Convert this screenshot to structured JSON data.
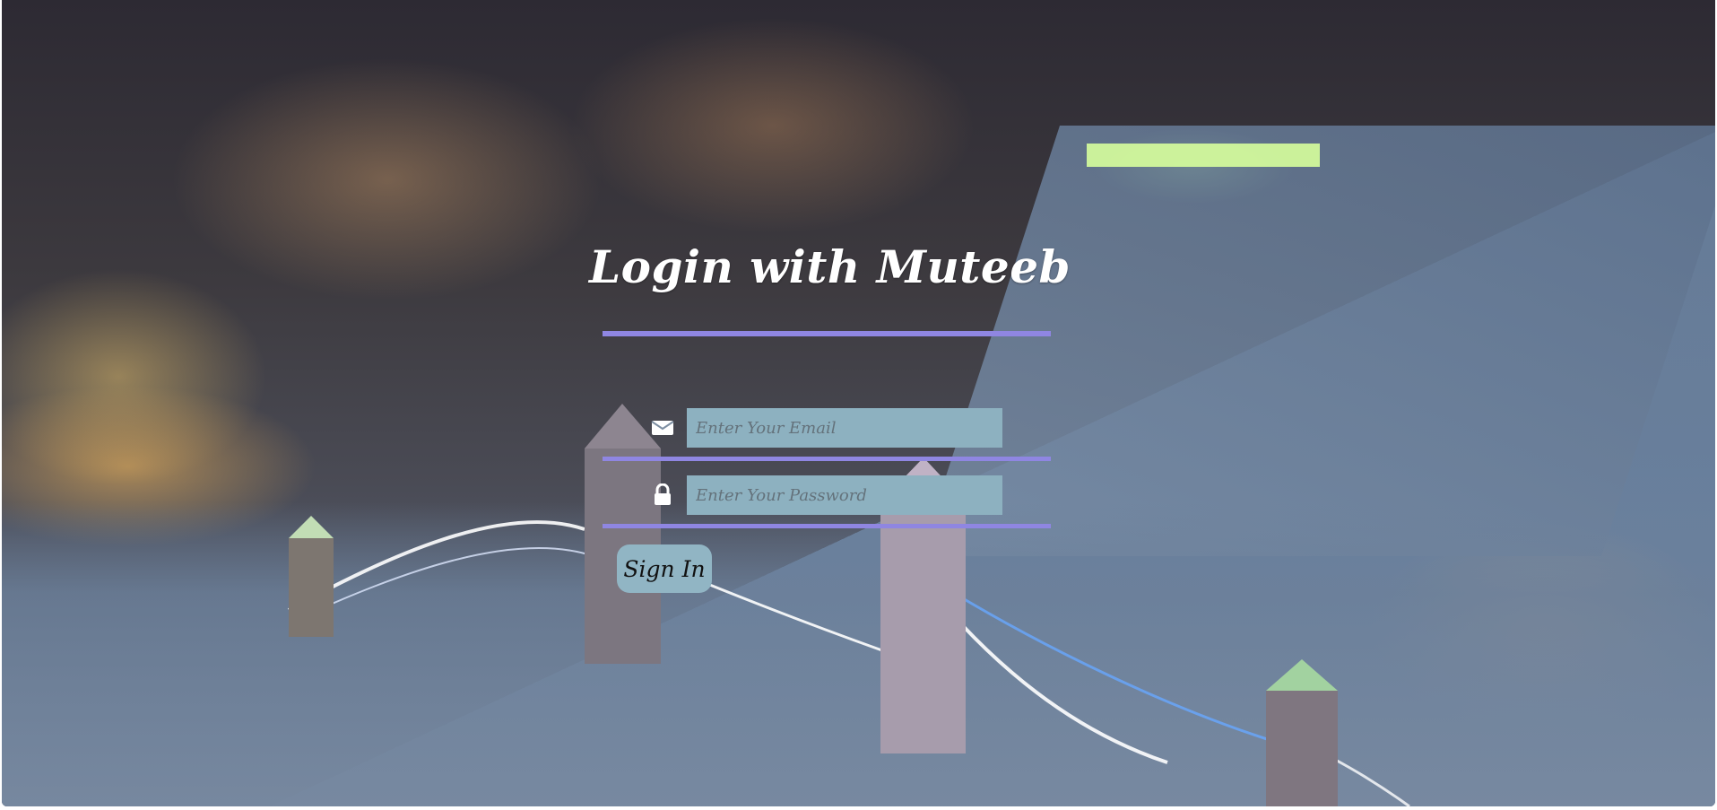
{
  "page": {
    "title": "Login with Muteeb"
  },
  "form": {
    "email": {
      "value": "",
      "placeholder": "Enter Your Email",
      "icon": "envelope-icon"
    },
    "password": {
      "value": "",
      "placeholder": "Enter Your Password",
      "icon": "lock-icon"
    },
    "submit_label": "Sign In"
  },
  "colors": {
    "accent": "#8f86e2",
    "input_bg": "#8db1c0",
    "button_bg": "#91b5c4",
    "title": "#ffffff"
  }
}
